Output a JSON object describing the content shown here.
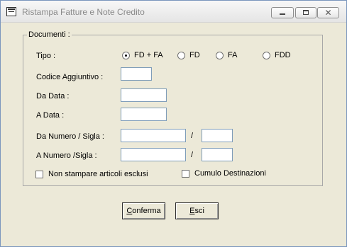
{
  "window": {
    "title": "Ristampa Fatture e Note Credito"
  },
  "controls": {
    "minimize": "minimize",
    "maximize": "maximize",
    "close": "✕"
  },
  "group": {
    "legend": "Documenti :"
  },
  "tipo": {
    "label": "Tipo :",
    "options": [
      "FD + FA",
      "FD",
      "FA",
      "FDD"
    ],
    "selected": "FD + FA"
  },
  "fields": {
    "codice": {
      "label": "Codice Aggiuntivo :",
      "value": ""
    },
    "da_data": {
      "label": "Da Data :",
      "value": ""
    },
    "a_data": {
      "label": "A Data :",
      "value": ""
    },
    "da_numero": {
      "label": "Da Numero / Sigla :",
      "numero": "",
      "sigla": ""
    },
    "a_numero": {
      "label": "A Numero /Sigla :",
      "numero": "",
      "sigla": ""
    },
    "separator": "/"
  },
  "checkboxes": {
    "non_stampare": {
      "label": "Non stampare articoli esclusi",
      "checked": false
    },
    "cumulo": {
      "label": "Cumulo Destinazioni",
      "checked": false
    }
  },
  "buttons": {
    "conferma": {
      "underline": "C",
      "rest": "onferma"
    },
    "esci": {
      "underline": "E",
      "rest": "sci"
    }
  }
}
